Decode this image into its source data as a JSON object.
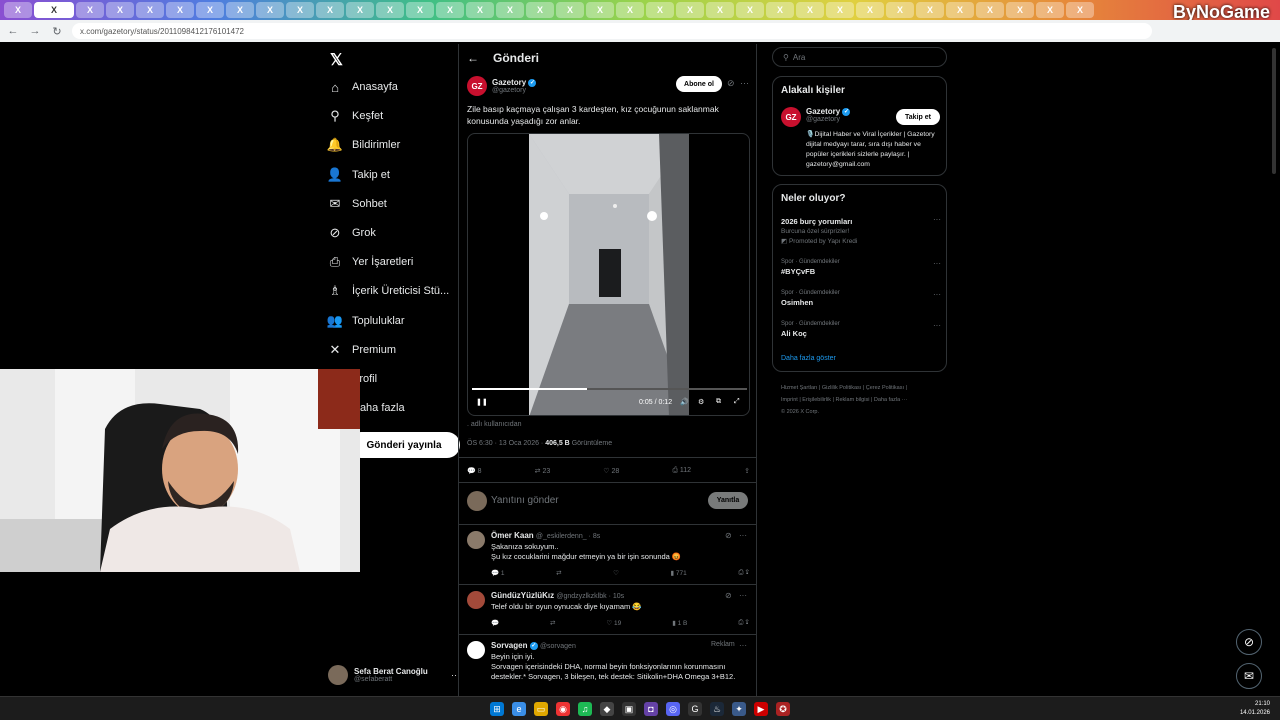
{
  "browser": {
    "tab_label": "X",
    "active_tab_label": "X",
    "url": "x.com/gazetory/status/2011098412176101472",
    "watermark": "ByNoGame"
  },
  "nav": {
    "items": [
      {
        "label": "Anasayfa",
        "icon": "home-icon",
        "glyph": "⌂"
      },
      {
        "label": "Keşfet",
        "icon": "search-icon",
        "glyph": "⚲"
      },
      {
        "label": "Bildirimler",
        "icon": "bell-icon",
        "glyph": "🔔"
      },
      {
        "label": "Takip et",
        "icon": "follow-icon",
        "glyph": "👤"
      },
      {
        "label": "Sohbet",
        "icon": "mail-icon",
        "glyph": "✉"
      },
      {
        "label": "Grok",
        "icon": "grok-icon",
        "glyph": "⊘"
      },
      {
        "label": "Yer İşaretleri",
        "icon": "bookmark-icon",
        "glyph": "⎙"
      },
      {
        "label": "İçerik Üreticisi Stü...",
        "icon": "creator-icon",
        "glyph": "♗"
      },
      {
        "label": "Topluluklar",
        "icon": "communities-icon",
        "glyph": "👥"
      },
      {
        "label": "Premium",
        "icon": "x-premium-icon",
        "glyph": "✕"
      },
      {
        "label": "Profil",
        "icon": "profile-icon",
        "glyph": "○"
      },
      {
        "label": "Daha fazla",
        "icon": "more-icon",
        "glyph": "⋯"
      }
    ],
    "post_button": "Gönderi yayınla",
    "account_name": "Sefa Berat Canoğlu",
    "account_handle": "@sefaberatt"
  },
  "post": {
    "header": "Gönderi",
    "author": "Gazetory",
    "handle": "@gazetory",
    "subscribe": "Abone ol",
    "text": "Zile basıp kaçmaya çalışan 3 kardeşten, kız çocuğunun saklanmak konusunda yaşadığı zor anlar.",
    "video_time": "0:05 / 0:12",
    "source": ". adlı kullanıcıdan",
    "timestamp": "ÖS 6:30 · 13 Oca 2026 · ",
    "views": "406,5 B",
    "views_label": " Görüntüleme",
    "replies": "8",
    "reposts": "23",
    "likes": "28",
    "bookmarks": "112",
    "reply_placeholder": "Yanıtını gönder",
    "reply_button": "Yanıtla"
  },
  "replies": [
    {
      "name": "Ömer Kaan",
      "handle": "@_eskilerdenn_ · 8s",
      "text1": "Şakanıza sokuyum..",
      "text2": "Şu kız cocuklarini mağdur etmeyin ya bir işin sonunda 😡",
      "c": "1",
      "r": "",
      "l": "",
      "v": "771"
    },
    {
      "name": "GündüzYüzlüKız",
      "handle": "@gndzyzlkzklbk · 10s",
      "text1": "Telef oldu bir oyun oynucak diye kıyamam 😂",
      "text2": "",
      "c": "",
      "r": "",
      "l": "19",
      "v": "1 B"
    },
    {
      "name": "Sorvagen",
      "handle": "@sorvagen",
      "ad": "Reklam",
      "text1": "Beyin için iyi.",
      "text2": "Sorvagen içerisindeki DHA, normal beyin fonksiyonlarının korunmasını destekler.* Sorvagen, 3 bileşen, tek destek: Sitikolin+DHA Omega 3+B12."
    }
  ],
  "right": {
    "search_placeholder": "Ara",
    "related_title": "Alakalı kişiler",
    "related_name": "Gazetory",
    "related_handle": "@gazetory",
    "related_follow": "Takip et",
    "related_bio": "🎙️Dijital Haber ve Viral İçerikler | Gazetory dijital medyayı tarar, sıra dışı haber ve popüler içerikleri sizlerle paylaşır. | gazetory@gmail.com",
    "trends_title": "Neler oluyor?",
    "trends": [
      {
        "cat": "",
        "title": "2026 burç yorumları",
        "sub": "Burcuna özel sürprizler!",
        "sub2": "Promoted by Yapı Kredi"
      },
      {
        "cat": "Spor · Gündemdekiler",
        "title": "#BYÇvFB",
        "sub": "",
        "sub2": ""
      },
      {
        "cat": "Spor · Gündemdekiler",
        "title": "Osimhen",
        "sub": "",
        "sub2": ""
      },
      {
        "cat": "Spor · Gündemdekiler",
        "title": "Ali Koç",
        "sub": "",
        "sub2": ""
      }
    ],
    "show_more": "Daha fazla göster",
    "footer1": "Hizmet Şartları  |  Gizlilik Politikası  |  Çerez Politikası  |",
    "footer2": "Imprint  |  Erişilebilirlik  |  Reklam bilgisi  |  Daha fazla ···",
    "footer3": "© 2026 X Corp."
  },
  "taskbar": {
    "time": "21:10",
    "date": "14.01.2026"
  },
  "colors": {
    "accent": "#1d9bf0",
    "brand_red": "#c8102e",
    "border": "#2f3336"
  }
}
